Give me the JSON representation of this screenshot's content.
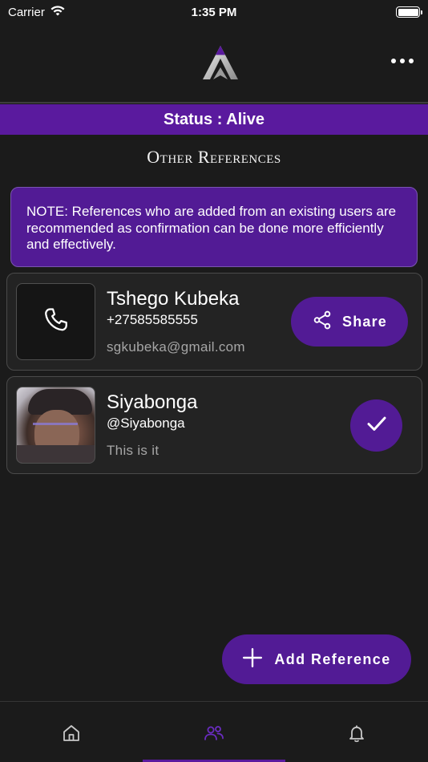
{
  "status_bar": {
    "carrier": "Carrier",
    "time": "1:35 PM"
  },
  "header": {
    "logo_icon": "app-logo-a",
    "menu_icon": "more-horizontal-icon"
  },
  "status_strip": {
    "text": "Status : Alive",
    "color": "#5a1a9e"
  },
  "section": {
    "title": "Other References"
  },
  "note": {
    "text": "NOTE: References who are added from an existing users are recommended as confirmation can be done more efficiently and effectively."
  },
  "references": [
    {
      "name": "Tshego Kubeka",
      "subtitle": "+27585585555",
      "detail": "sgkubeka@gmail.com",
      "thumb_icon": "phone-icon",
      "action": {
        "label": "Share",
        "icon": "share-icon"
      }
    },
    {
      "name": "Siyabonga",
      "subtitle": "@Siyabonga",
      "detail": "This is it",
      "thumb_icon": "avatar-photo",
      "action": {
        "icon": "check-icon"
      }
    }
  ],
  "fab": {
    "label": "Add Reference",
    "icon": "plus-icon"
  },
  "bottom_nav": {
    "items": [
      {
        "icon": "home-icon",
        "active": false
      },
      {
        "icon": "people-icon",
        "active": true
      },
      {
        "icon": "bell-icon",
        "active": false
      }
    ]
  },
  "colors": {
    "accent": "#521b95",
    "background": "#1b1b1b",
    "card": "#232323"
  }
}
